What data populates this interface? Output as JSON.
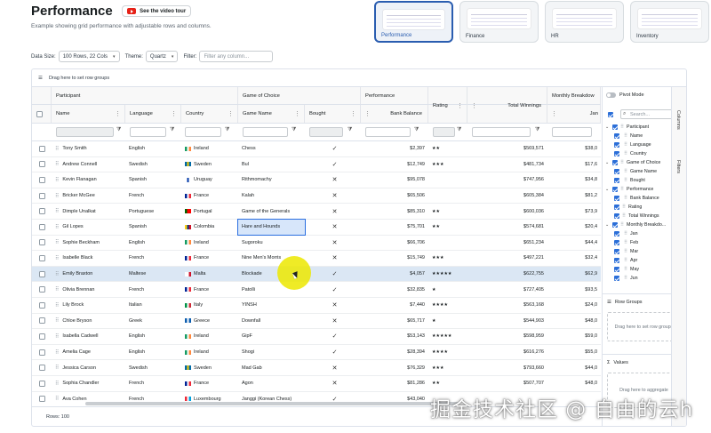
{
  "header": {
    "title": "Performance",
    "video_button": "See the video tour",
    "description": "Example showing grid performance with adjustable rows and columns."
  },
  "thumbnails": [
    {
      "label": "Performance",
      "active": true
    },
    {
      "label": "Finance",
      "active": false
    },
    {
      "label": "HR",
      "active": false
    },
    {
      "label": "Inventory",
      "active": false
    }
  ],
  "options": {
    "data_size_label": "Data Size:",
    "data_size_value": "100 Rows, 22 Cols",
    "theme_label": "Theme:",
    "theme_value": "Quartz",
    "filter_label": "Filter:",
    "filter_placeholder": "Filter any column..."
  },
  "grid": {
    "row_group_hint": "Drag here to set row groups",
    "groups": {
      "participant": "Participant",
      "game": "Game of Choice",
      "performance": "Performance",
      "monthly": "Monthly Breakdow"
    },
    "columns": {
      "name": "Name",
      "language": "Language",
      "country": "Country",
      "game_name": "Game Name",
      "bought": "Bought",
      "bank_balance": "Bank Balance",
      "rating": "Rating",
      "total_winnings": "Total Winnings",
      "jan": "Jan"
    },
    "rows": [
      {
        "name": "Tony Smith",
        "language": "English",
        "country": "Ireland",
        "flag": "ie",
        "game": "Chess",
        "bought": "✓",
        "balance": "$2,397",
        "rating": "★★",
        "winnings": "$569,571",
        "jan": "$38,0"
      },
      {
        "name": "Andrew Connell",
        "language": "Swedish",
        "country": "Sweden",
        "flag": "se",
        "game": "Bul",
        "bought": "✓",
        "balance": "$12,749",
        "rating": "★★★",
        "winnings": "$481,734",
        "jan": "$17,6"
      },
      {
        "name": "Kevin Flanagan",
        "language": "Spanish",
        "country": "Uruguay",
        "flag": "uy",
        "game": "Rithmomachy",
        "bought": "✕",
        "balance": "$95,078",
        "rating": "",
        "winnings": "$747,956",
        "jan": "$34,8"
      },
      {
        "name": "Bricker McGee",
        "language": "French",
        "country": "France",
        "flag": "fr",
        "game": "Kalah",
        "bought": "✕",
        "balance": "$65,506",
        "rating": "",
        "winnings": "$605,384",
        "jan": "$81,2"
      },
      {
        "name": "Dimple Unalkat",
        "language": "Portuguese",
        "country": "Portugal",
        "flag": "pt",
        "game": "Game of the Generals",
        "bought": "✕",
        "balance": "$85,310",
        "rating": "★★",
        "winnings": "$600,036",
        "jan": "$73,9"
      },
      {
        "name": "Gil Lopes",
        "language": "Spanish",
        "country": "Colombia",
        "flag": "co",
        "game": "Hare and Hounds",
        "bought": "✕",
        "balance": "$75,701",
        "rating": "★★",
        "winnings": "$574,681",
        "jan": "$20,4"
      },
      {
        "name": "Sophie Beckham",
        "language": "English",
        "country": "Ireland",
        "flag": "ie",
        "game": "Sugoroku",
        "bought": "✕",
        "balance": "$66,706",
        "rating": "",
        "winnings": "$651,234",
        "jan": "$44,4"
      },
      {
        "name": "Isabelle Black",
        "language": "French",
        "country": "France",
        "flag": "fr",
        "game": "Nine Men's Morris",
        "bought": "✕",
        "balance": "$15,749",
        "rating": "★★★",
        "winnings": "$497,221",
        "jan": "$32,4"
      },
      {
        "name": "Emily Braxton",
        "language": "Maltese",
        "country": "Malta",
        "flag": "mt",
        "game": "Blockade",
        "bought": "✓",
        "balance": "$4,057",
        "rating": "★★★★★",
        "winnings": "$622,755",
        "jan": "$62,9"
      },
      {
        "name": "Olivia Brennan",
        "language": "French",
        "country": "France",
        "flag": "fr",
        "game": "Patolli",
        "bought": "✓",
        "balance": "$32,835",
        "rating": "★",
        "winnings": "$727,405",
        "jan": "$93,5"
      },
      {
        "name": "Lily Brock",
        "language": "Italian",
        "country": "Italy",
        "flag": "it",
        "game": "YINSH",
        "bought": "✕",
        "balance": "$7,440",
        "rating": "★★★★",
        "winnings": "$563,168",
        "jan": "$24,0"
      },
      {
        "name": "Chloe Bryson",
        "language": "Greek",
        "country": "Greece",
        "flag": "gr",
        "game": "Downfall",
        "bought": "✕",
        "balance": "$65,717",
        "rating": "★",
        "winnings": "$544,903",
        "jan": "$48,0"
      },
      {
        "name": "Isabella Cadwell",
        "language": "English",
        "country": "Ireland",
        "flag": "ie",
        "game": "GipF",
        "bought": "✓",
        "balance": "$53,143",
        "rating": "★★★★★",
        "winnings": "$598,959",
        "jan": "$59,0"
      },
      {
        "name": "Amelia Cage",
        "language": "English",
        "country": "Ireland",
        "flag": "ie",
        "game": "Shogi",
        "bought": "✓",
        "balance": "$28,394",
        "rating": "★★★★",
        "winnings": "$616,276",
        "jan": "$55,0"
      },
      {
        "name": "Jessica Carson",
        "language": "Swedish",
        "country": "Sweden",
        "flag": "se",
        "game": "Mad Gab",
        "bought": "✕",
        "balance": "$76,329",
        "rating": "★★★",
        "winnings": "$793,660",
        "jan": "$44,0"
      },
      {
        "name": "Sophia Chandler",
        "language": "French",
        "country": "France",
        "flag": "fr",
        "game": "Agon",
        "bought": "✕",
        "balance": "$81,286",
        "rating": "★★",
        "winnings": "$507,707",
        "jan": "$48,0"
      },
      {
        "name": "Ava Cohen",
        "language": "French",
        "country": "Luxembourg",
        "flag": "lu",
        "game": "Janggi (Korean Chess)",
        "bought": "✓",
        "balance": "$43,040",
        "rating": "",
        "winnings": "",
        "jan": ""
      }
    ],
    "status": "Rows: 100"
  },
  "tool_panel": {
    "pivot_mode": "Pivot Mode",
    "search_placeholder": "Search...",
    "tabs": [
      "Columns",
      "Filters"
    ],
    "tree": [
      {
        "label": "Participant",
        "level": 0,
        "group": true
      },
      {
        "label": "Name",
        "level": 1
      },
      {
        "label": "Language",
        "level": 1
      },
      {
        "label": "Country",
        "level": 1
      },
      {
        "label": "Game of Choice",
        "level": 0,
        "group": true
      },
      {
        "label": "Game Name",
        "level": 1
      },
      {
        "label": "Bought",
        "level": 1
      },
      {
        "label": "Performance",
        "level": 0,
        "group": true
      },
      {
        "label": "Bank Balance",
        "level": 1
      },
      {
        "label": "Rating",
        "level": 0
      },
      {
        "label": "Total Winnings",
        "level": 0
      },
      {
        "label": "Monthly Breakdo...",
        "level": 0,
        "group": true
      },
      {
        "label": "Jan",
        "level": 1
      },
      {
        "label": "Feb",
        "level": 1
      },
      {
        "label": "Mar",
        "level": 1
      },
      {
        "label": "Apr",
        "level": 1
      },
      {
        "label": "May",
        "level": 1
      },
      {
        "label": "Jun",
        "level": 1
      }
    ],
    "row_groups_title": "Row Groups",
    "row_groups_hint": "Drag here to set row groups",
    "values_title": "Values",
    "values_hint": "Drag here to aggregate"
  },
  "flag_colors": {
    "ie": [
      "#169b62",
      "#ffffff",
      "#ff883e"
    ],
    "se": [
      "#006aa7",
      "#fecc00",
      "#006aa7"
    ],
    "uy": [
      "#ffffff",
      "#0038a8",
      "#ffffff"
    ],
    "fr": [
      "#002395",
      "#ffffff",
      "#ed2939"
    ],
    "pt": [
      "#006600",
      "#ff0000",
      "#ff0000"
    ],
    "co": [
      "#fcd116",
      "#003893",
      "#ce1126"
    ],
    "mt": [
      "#ffffff",
      "#ffffff",
      "#cf142b"
    ],
    "it": [
      "#009246",
      "#ffffff",
      "#ce2b37"
    ],
    "gr": [
      "#0d5eaf",
      "#ffffff",
      "#0d5eaf"
    ],
    "lu": [
      "#ed2939",
      "#ffffff",
      "#00a1de"
    ]
  },
  "watermark": "掘金技术社区 @ 自由的云h"
}
